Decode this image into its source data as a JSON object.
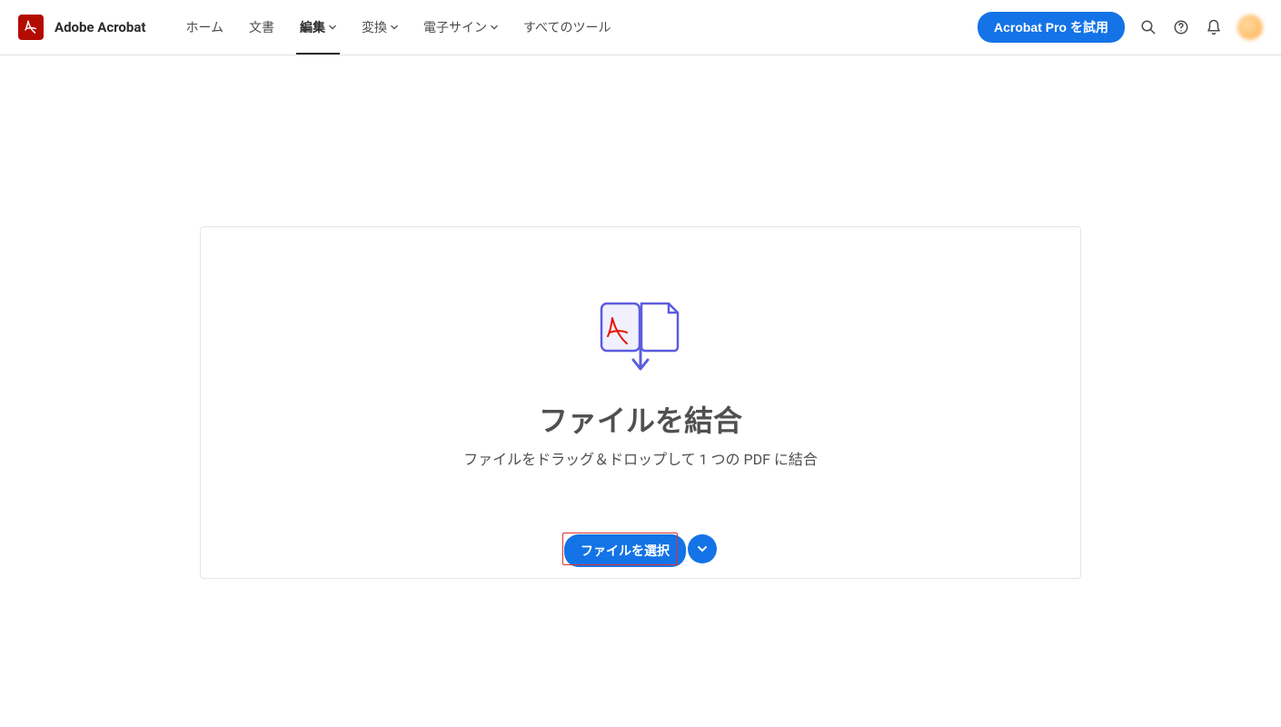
{
  "brand": "Adobe Acrobat",
  "nav": [
    {
      "label": "ホーム",
      "hasDropdown": false,
      "active": false
    },
    {
      "label": "文書",
      "hasDropdown": false,
      "active": false
    },
    {
      "label": "編集",
      "hasDropdown": true,
      "active": true
    },
    {
      "label": "変換",
      "hasDropdown": true,
      "active": false
    },
    {
      "label": "電子サイン",
      "hasDropdown": true,
      "active": false
    },
    {
      "label": "すべてのツール",
      "hasDropdown": false,
      "active": false
    }
  ],
  "cta": "Acrobat Pro を試用",
  "dropzone": {
    "title": "ファイルを結合",
    "subtitle": "ファイルをドラッグ＆ドロップして 1 つの PDF に結合",
    "selectButton": "ファイルを選択"
  },
  "colors": {
    "primaryButton": "#1473e6",
    "logo": "#b30b00",
    "highlightBorder": "#e03030",
    "illustration": "#5c5ce0"
  }
}
